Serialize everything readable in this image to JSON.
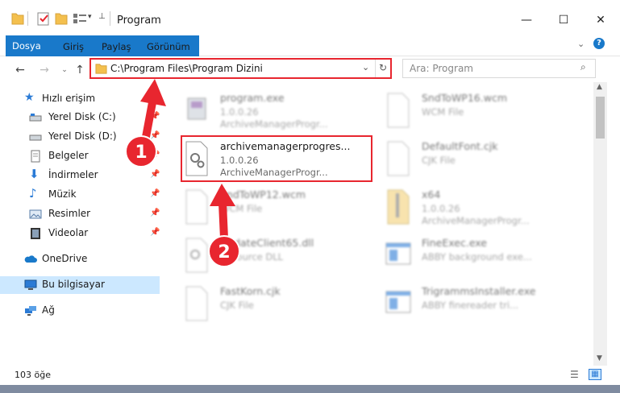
{
  "window": {
    "title": "Program"
  },
  "ribbon": {
    "tabs": [
      "Dosya",
      "Giriş",
      "Paylaş",
      "Görünüm"
    ]
  },
  "address": {
    "path": "C:\\Program Files\\Program Dizini"
  },
  "search": {
    "placeholder": "Ara: Program"
  },
  "sidebar": {
    "items": [
      {
        "label": "Hızlı erişim",
        "icon": "star-icon"
      },
      {
        "label": "Yerel Disk (C:)",
        "icon": "drive-icon"
      },
      {
        "label": "Yerel Disk (D:)",
        "icon": "drive-icon"
      },
      {
        "label": "Belgeler",
        "icon": "documents-icon"
      },
      {
        "label": "İndirmeler",
        "icon": "download-icon"
      },
      {
        "label": "Müzik",
        "icon": "music-icon"
      },
      {
        "label": "Resimler",
        "icon": "pictures-icon"
      },
      {
        "label": "Videolar",
        "icon": "video-icon"
      },
      {
        "label": "OneDrive",
        "icon": "cloud-icon"
      },
      {
        "label": "Bu bilgisayar",
        "icon": "computer-icon"
      },
      {
        "label": "Ağ",
        "icon": "network-icon"
      }
    ]
  },
  "files": [
    {
      "name": "program.exe",
      "line2": "1.0.0.26",
      "line3": "ArchiveManagerProgr..."
    },
    {
      "name": "SndToWP16.wcm",
      "line2": "WCM File",
      "line3": ""
    },
    {
      "name": "archivemanagerprogres...",
      "line2": "1.0.0.26",
      "line3": "ArchiveManagerProgr..."
    },
    {
      "name": "DefaultFont.cjk",
      "line2": "CJK File",
      "line3": ""
    },
    {
      "name": "SndToWP12.wcm",
      "line2": "WCM File",
      "line3": ""
    },
    {
      "name": "x64",
      "line2": "1.0.0.26",
      "line3": "ArchiveManagerProgr..."
    },
    {
      "name": "UpdateClient65.dll",
      "line2": "Resource DLL",
      "line3": ""
    },
    {
      "name": "FineExec.exe",
      "line2": "ABBY background exe...",
      "line3": ""
    },
    {
      "name": "FastKorn.cjk",
      "line2": "CJK File",
      "line3": ""
    },
    {
      "name": "TrigrammsInstaller.exe",
      "line2": "ABBY finereader tri...",
      "line3": ""
    }
  ],
  "status": {
    "count": "103 öğe"
  },
  "badges": [
    "1",
    "2"
  ],
  "colors": {
    "accent": "#1979ca",
    "highlight": "#e8262f"
  }
}
